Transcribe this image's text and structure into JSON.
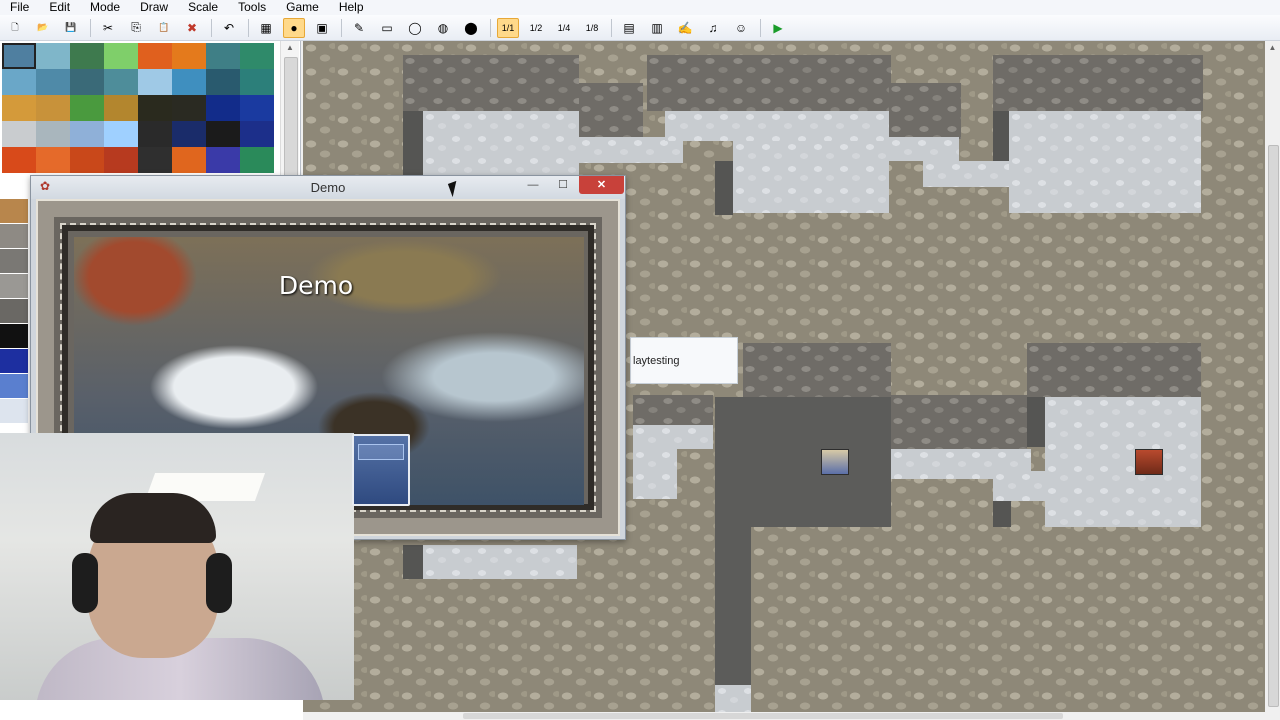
{
  "menubar": {
    "items": [
      "File",
      "Edit",
      "Mode",
      "Draw",
      "Scale",
      "Tools",
      "Game",
      "Help"
    ]
  },
  "toolbar": {
    "buttons": [
      {
        "icon": "new-project-icon",
        "glyph": "🗋"
      },
      {
        "icon": "open-project-icon",
        "glyph": "📂"
      },
      {
        "icon": "save-project-icon",
        "glyph": "💾"
      },
      {
        "icon": "cut-icon",
        "glyph": "✂"
      },
      {
        "icon": "copy-icon",
        "glyph": "⎘"
      },
      {
        "icon": "paste-icon",
        "glyph": "📋"
      },
      {
        "icon": "delete-icon",
        "glyph": "✖"
      },
      {
        "icon": "undo-icon",
        "glyph": "↶"
      },
      {
        "icon": "map-layer-icon",
        "glyph": "▦"
      },
      {
        "icon": "event-layer-icon",
        "glyph": "●"
      },
      {
        "icon": "region-layer-icon",
        "glyph": "▣"
      },
      {
        "icon": "pencil-icon",
        "glyph": "✎"
      },
      {
        "icon": "rectangle-icon",
        "glyph": "▭"
      },
      {
        "icon": "ellipse-icon",
        "glyph": "◯"
      },
      {
        "icon": "fill-icon",
        "glyph": "◍"
      },
      {
        "icon": "shadow-pen-icon",
        "glyph": "⬤"
      },
      {
        "icon": "zoom-1-1-icon",
        "glyph": "1/1"
      },
      {
        "icon": "zoom-1-2-icon",
        "glyph": "1/2"
      },
      {
        "icon": "zoom-1-4-icon",
        "glyph": "1/4"
      },
      {
        "icon": "zoom-1-8-icon",
        "glyph": "1/8"
      },
      {
        "icon": "database-icon",
        "glyph": "▤"
      },
      {
        "icon": "resource-manager-icon",
        "glyph": "▥"
      },
      {
        "icon": "script-editor-icon",
        "glyph": "✍"
      },
      {
        "icon": "sound-test-icon",
        "glyph": "♫"
      },
      {
        "icon": "character-generator-icon",
        "glyph": "☺"
      },
      {
        "icon": "playtest-icon",
        "glyph": "▶"
      }
    ],
    "colors": {
      "accent": "#ffd98a",
      "playtest": "#1a9c2a"
    }
  },
  "palette": {
    "tile_colors": [
      "#4f7fa0",
      "#7fb6c9",
      "#3e7a4e",
      "#7fcf6a",
      "#e0601e",
      "#e47a1c",
      "#3f7f86",
      "#2f8a6a",
      "#6aa7c8",
      "#4f8aa8",
      "#3a6a78",
      "#4e8d9a",
      "#9fc9e6",
      "#3f8fbf",
      "#295a6e",
      "#2c7f7a",
      "#d49a3a",
      "#c8923a",
      "#4a9a3e",
      "#b3862e",
      "#2a2a1e",
      "#2a2a22",
      "#122c8a",
      "#1a3aa0",
      "#c9cccf",
      "#a9b6bd",
      "#8fb0d8",
      "#9fd0ff",
      "#2a2a2a",
      "#1a2c6a",
      "#1b1b1b",
      "#1c2f8a",
      "#d84a1a",
      "#e56a2a",
      "#c9481a",
      "#b73a1f",
      "#2f2f2f",
      "#e0661e",
      "#3a3aa8",
      "#2a8a5a"
    ],
    "lower_colors": [
      "#b8864c",
      "#8e8a84",
      "#7a7874",
      "#9a9894",
      "#6a6864",
      "#111111",
      "#1d2fa0",
      "#5a7fcf",
      "#dde4ee"
    ]
  },
  "game_window": {
    "title": "Demo",
    "minimize_label": "—",
    "maximize_label": "☐",
    "close_label": "✕",
    "game_title": "Demo"
  },
  "tooltip": {
    "text": "laytesting"
  }
}
